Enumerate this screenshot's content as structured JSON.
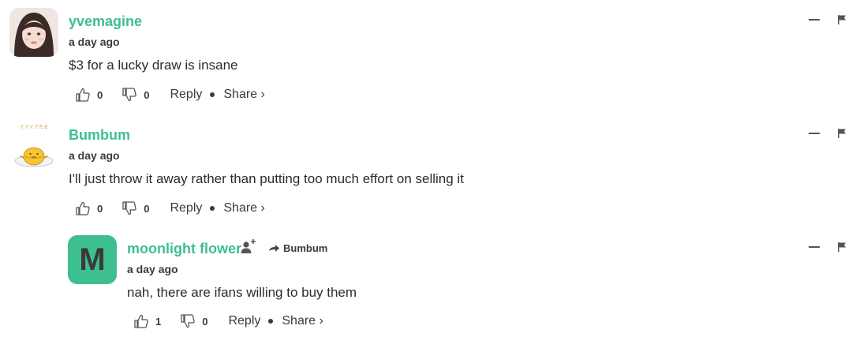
{
  "comments": [
    {
      "username": "yvemagine",
      "timestamp": "a day ago",
      "text": "$3 for a lucky draw is insane",
      "likes": "0",
      "dislikes": "0",
      "reply_label": "Reply",
      "share_label": "Share ›"
    },
    {
      "username": "Bumbum",
      "timestamp": "a day ago",
      "text": "I'll just throw it away rather than putting too much effort on selling it",
      "likes": "0",
      "dislikes": "0",
      "reply_label": "Reply",
      "share_label": "Share ›",
      "avatar_caption": "ぐでぐでたま"
    },
    {
      "username": "moonlight flower",
      "avatar_letter": "M",
      "reply_to": "Bumbum",
      "timestamp": "a day ago",
      "text": "nah, there are ifans willing to buy them",
      "likes": "1",
      "dislikes": "0",
      "reply_label": "Reply",
      "share_label": "Share ›"
    }
  ],
  "colors": {
    "accent": "#3dbf8f",
    "text": "#2b2b2b",
    "muted": "#3a3a3a"
  },
  "icons": {
    "like": "thumbs-up-icon",
    "dislike": "thumbs-down-icon",
    "minimize": "minimize-icon",
    "flag": "flag-icon",
    "follow": "add-user-icon",
    "reply_arrow": "reply-arrow-icon"
  }
}
